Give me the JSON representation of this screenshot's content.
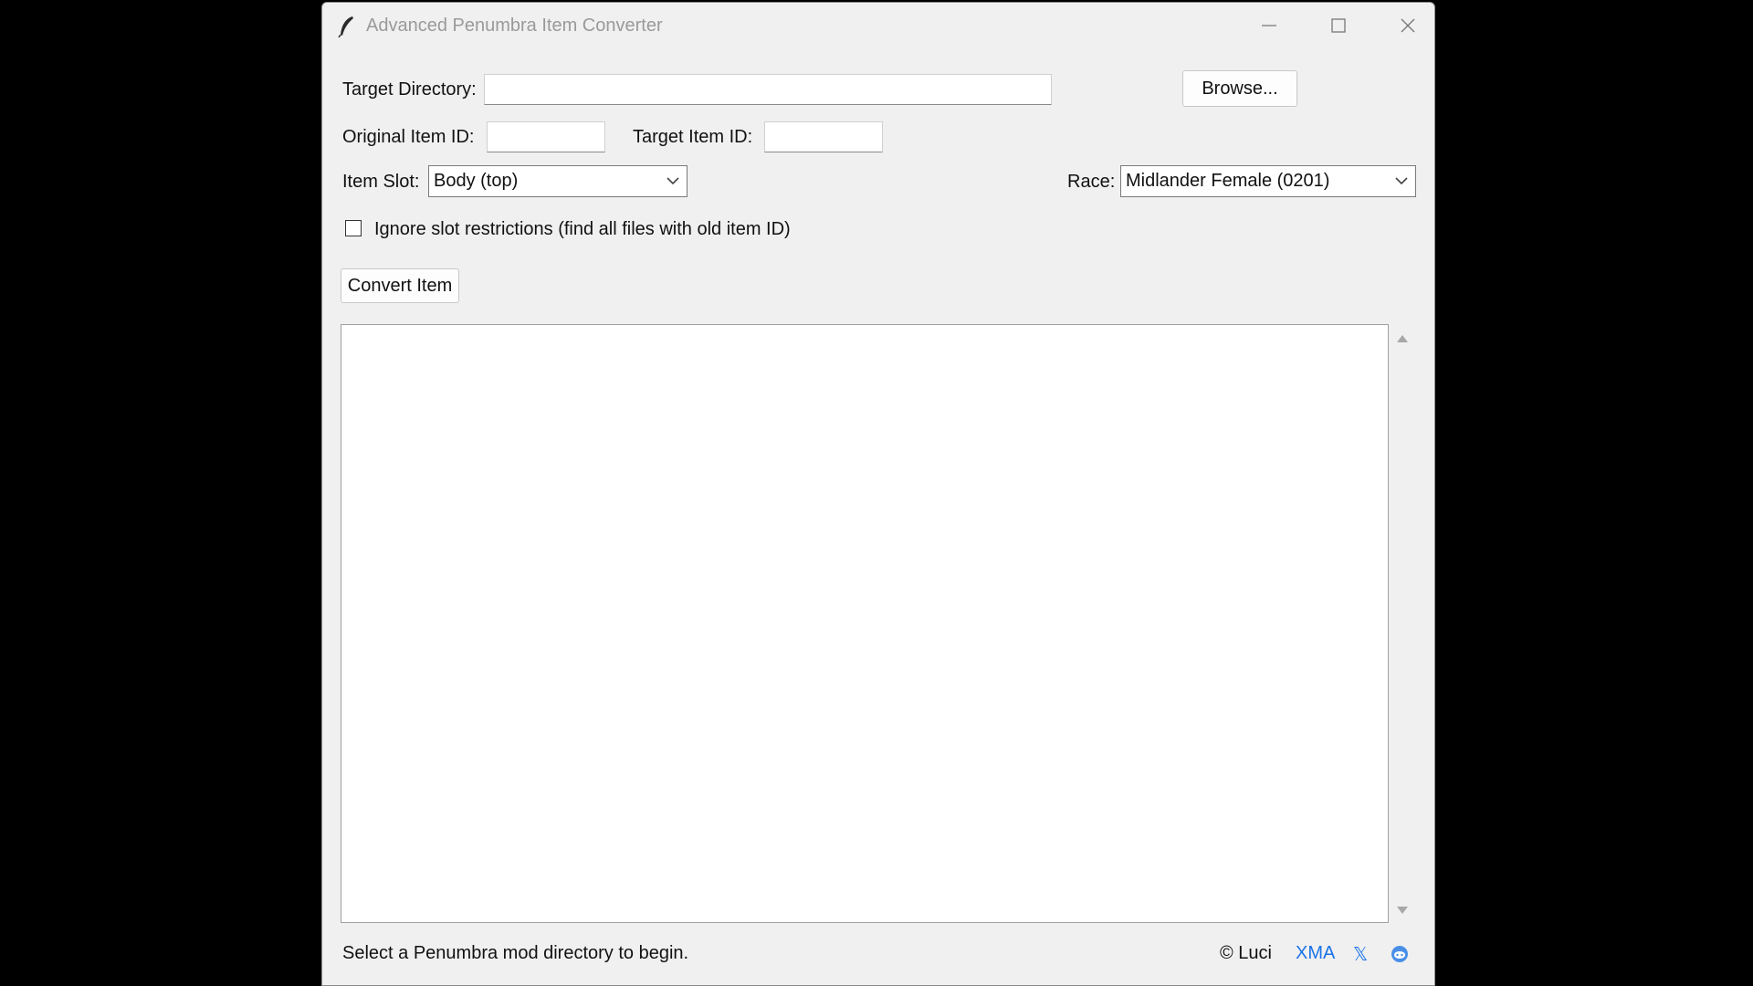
{
  "window": {
    "title": "Advanced Penumbra Item Converter"
  },
  "form": {
    "target_directory_label": "Target Directory:",
    "target_directory_value": "",
    "browse_label": "Browse...",
    "original_item_id_label": "Original Item ID:",
    "original_item_id_value": "",
    "target_item_id_label": "Target Item ID:",
    "target_item_id_value": "",
    "item_slot_label": "Item Slot:",
    "item_slot_value": "Body (top)",
    "race_label": "Race:",
    "race_value": "Midlander Female (0201)",
    "ignore_slot_label": "Ignore slot restrictions (find all files with old item ID)",
    "ignore_slot_checked": false,
    "convert_label": "Convert Item"
  },
  "output": {
    "log_text": ""
  },
  "footer": {
    "status_text": "Select a Penumbra mod directory to begin.",
    "copyright": "© Luci",
    "link_xma": "XMA",
    "link_x": "𝕏",
    "link_color": "#1a73e8"
  }
}
